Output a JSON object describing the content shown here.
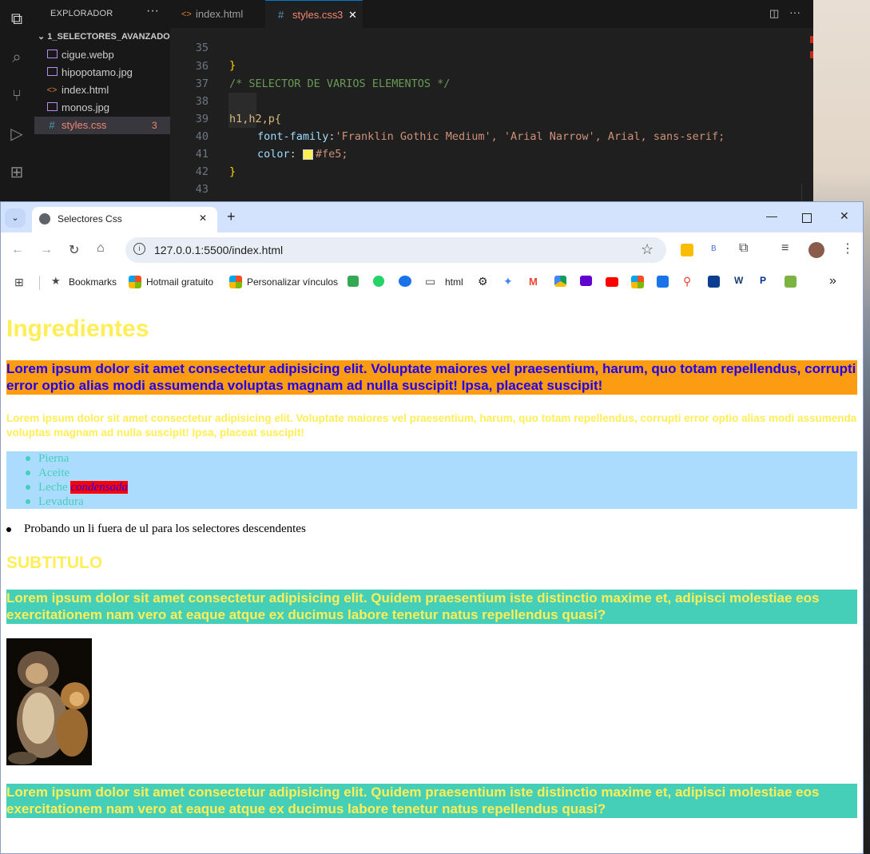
{
  "vscode": {
    "explorer_title": "EXPLORADOR",
    "more_label": "···",
    "folder": "1_SELECTORES_AVANZADOS",
    "files": [
      {
        "name": "cigue.webp",
        "type": "image"
      },
      {
        "name": "hipopotamo.jpg",
        "type": "image"
      },
      {
        "name": "index.html",
        "type": "html"
      },
      {
        "name": "monos.jpg",
        "type": "image"
      },
      {
        "name": "styles.css",
        "type": "css",
        "badge": "3"
      }
    ],
    "tabs": [
      {
        "label": "index.html"
      },
      {
        "label": "styles.css",
        "badge": "3"
      }
    ],
    "code_lines": [
      {
        "num": "35",
        "text": "}"
      },
      {
        "num": "36",
        "text": "/* SELECTOR DE VARIOS ELEMENTOS */"
      },
      {
        "num": "37",
        "text": ""
      },
      {
        "num": "38",
        "text": "h1,h2,p{"
      },
      {
        "num": "39",
        "prop": "font-family",
        "value": "'Franklin Gothic Medium', 'Arial Narrow', Arial, sans-serif;"
      },
      {
        "num": "40",
        "prop": "color",
        "value": "#fe5;"
      },
      {
        "num": "41",
        "text": "}"
      },
      {
        "num": "42",
        "text": ""
      },
      {
        "num": "43",
        "text": ""
      }
    ],
    "color_swatch": "#ffee55"
  },
  "browser": {
    "tab_title": "Selectores Css",
    "url": "127.0.0.1:5500/index.html",
    "bookmarks": [
      "Bookmarks",
      "Hotmail gratuito",
      "Personalizar vínculos",
      "html"
    ],
    "more_bookmarks": "»"
  },
  "page": {
    "h1": "Ingredientes",
    "para_orange": "Lorem ipsum dolor sit amet consectetur adipisicing elit. Voluptate maiores vel praesentium, harum, quo totam repellendus, corrupti error optio alias modi assumenda voluptas magnam ad nulla suscipit! Ipsa, placeat suscipit!",
    "para_yellow": "Lorem ipsum dolor sit amet consectetur adipisicing elit. Voluptate maiores vel praesentium, harum, quo totam repellendus, corrupti error optio alias modi assumenda voluptas magnam ad nulla suscipit! Ipsa, placeat suscipit!",
    "list": [
      "Pierna",
      "Aceite",
      "Leche",
      "Levadura"
    ],
    "list_em": "condensada",
    "outside_li": "Probando un li fuera de ul para los selectores descendentes",
    "h2": "SUBTITULO",
    "para_teal_1": "Lorem ipsum dolor sit amet consectetur adipisicing elit. Quidem praesentium iste distinctio maxime et, adipisci molestiae eos exercitationem nam vero at eaque atque ex ducimus labore tenetur natus repellendus quasi?",
    "para_teal_2": "Lorem ipsum dolor sit amet consectetur adipisicing elit. Quidem praesentium iste distinctio maxime et, adipisci molestiae eos exercitationem nam vero at eaque atque ex ducimus labore tenetur natus repellendus quasi?"
  },
  "colors": {
    "text_yellow": "#ffee55",
    "orange_bg": "#fb9c12",
    "blue_text": "#2200ee",
    "teal_bg": "#45cfb9",
    "list_bg": "#abdcfd"
  }
}
